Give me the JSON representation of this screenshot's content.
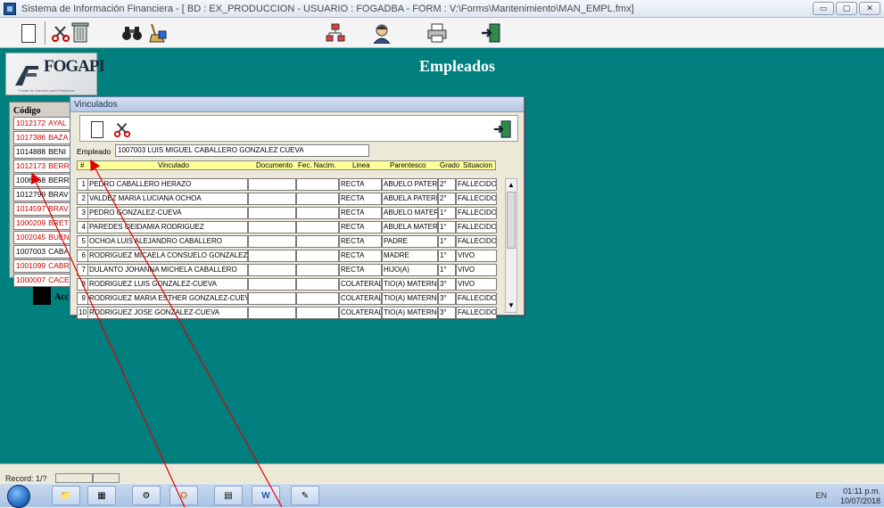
{
  "window": {
    "title": "Sistema de Información Financiera - [ BD : EX_PRODUCCION - USUARIO : FOGADBA - FORM : V:\\Forms\\Mantenimiento\\MAN_EMPL.fmx]",
    "buttons": [
      "▭",
      "▢",
      "✕"
    ]
  },
  "toolbar": {
    "new_icon": "document-icon",
    "cut_icon": "scissors-icon",
    "delete_icon": "trash-icon",
    "search_icon": "binoculars-icon",
    "clear_icon": "broom-icon",
    "org_icon": "hierarchy-icon",
    "user_icon": "user-icon",
    "print_icon": "printer-icon",
    "exit_icon": "exit-door-icon"
  },
  "logo": {
    "text": "FOGAPI",
    "sub": "Fondo de Garantía para Préstamos"
  },
  "page": {
    "heading": "Empleados"
  },
  "employees": {
    "header": "Código",
    "rows": [
      {
        "code": "1012172",
        "name": "AYAL",
        "red": true
      },
      {
        "code": "1017386",
        "name": "BAZA",
        "red": true
      },
      {
        "code": "1014888",
        "name": "BENI",
        "red": false
      },
      {
        "code": "1012173",
        "name": "BERR",
        "red": true
      },
      {
        "code": "1006168",
        "name": "BERR",
        "red": false
      },
      {
        "code": "1012799",
        "name": "BRAV",
        "red": false
      },
      {
        "code": "1014597",
        "name": "BRAV",
        "red": true
      },
      {
        "code": "1000209",
        "name": "BRET",
        "red": true
      },
      {
        "code": "1002045",
        "name": "BUEN",
        "red": true
      },
      {
        "code": "1007003",
        "name": "CABA",
        "red": false
      },
      {
        "code": "1001099",
        "name": "CABR",
        "red": true
      },
      {
        "code": "1000007",
        "name": "CACE",
        "red": true
      }
    ],
    "acc_label": "Acc"
  },
  "dialog": {
    "title": "Vinculados",
    "empleado_label": "Empleado",
    "empleado_value": "1007003 LUIS MIGUEL CABALLERO GONZALEZ CUEVA",
    "columns": {
      "num": "#",
      "vinculado": "Vinculado",
      "documento": "Documento",
      "fec_nacim": "Fec. Nacim.",
      "linea": "Linea",
      "parentesco": "Parentesco",
      "grado": "Grado",
      "situacion": "Situacion"
    },
    "rows": [
      {
        "num": "1",
        "vinculado": "PEDRO CABALLERO HERAZO",
        "documento": "",
        "fec": "",
        "linea": "RECTA",
        "parentesco": "ABUELO PATERN",
        "grado": "2°",
        "situacion": "FALLECIDO"
      },
      {
        "num": "2",
        "vinculado": "VALDEZ MARIA LUCIANA OCHOA",
        "documento": "",
        "fec": "",
        "linea": "RECTA",
        "parentesco": "ABUELA PATERN",
        "grado": "2°",
        "situacion": "FALLECIDO"
      },
      {
        "num": "3",
        "vinculado": "PEDRO GONZALEZ-CUEVA",
        "documento": "",
        "fec": "",
        "linea": "RECTA",
        "parentesco": "ABUELO MATERN",
        "grado": "1°",
        "situacion": "FALLECIDO"
      },
      {
        "num": "4",
        "vinculado": "PAREDES OEIDAMIA RODRIGUEZ",
        "documento": "",
        "fec": "",
        "linea": "RECTA",
        "parentesco": "ABUELA MATERN",
        "grado": "1°",
        "situacion": "FALLECIDO"
      },
      {
        "num": "5",
        "vinculado": "OCHOA LUIS ALEJANDRO CABALLERO",
        "documento": "",
        "fec": "",
        "linea": "RECTA",
        "parentesco": "PADRE",
        "grado": "1°",
        "situacion": "FALLECIDO"
      },
      {
        "num": "6",
        "vinculado": "RODRIGUEZ MICAELA CONSUELO GONZALEZ-CU",
        "documento": "",
        "fec": "",
        "linea": "RECTA",
        "parentesco": "MADRE",
        "grado": "1°",
        "situacion": "VIVO"
      },
      {
        "num": "7",
        "vinculado": "DULANTO JOHANNA MICHELA CABALLERO",
        "documento": "",
        "fec": "",
        "linea": "RECTA",
        "parentesco": "HIJO(A)",
        "grado": "1°",
        "situacion": "VIVO"
      },
      {
        "num": "8",
        "vinculado": "RODRIGUEZ LUIS GONZALEZ-CUEVA",
        "documento": "",
        "fec": "",
        "linea": "COLATERAL",
        "parentesco": "TIO(A) MATERNO",
        "grado": "3°",
        "situacion": "VIVO"
      },
      {
        "num": "9",
        "vinculado": "RODRIGUEZ MARIA ESTHER GONZALEZ-CUEVA",
        "documento": "",
        "fec": "",
        "linea": "COLATERAL",
        "parentesco": "TIO(A) MATERNO",
        "grado": "3°",
        "situacion": "FALLECIDO"
      },
      {
        "num": "10",
        "vinculado": "RODRIGUEZ JOSE GONZALEZ-CUEVA",
        "documento": "",
        "fec": "",
        "linea": "COLATERAL",
        "parentesco": "TIO(A) MATERNO",
        "grado": "3°",
        "situacion": "FALLECIDO"
      }
    ]
  },
  "status": {
    "record": "Record: 1/?"
  },
  "taskbar": {
    "apps": [
      "folder-icon",
      "calendar-icon",
      "network-icon",
      "outlook-icon",
      "forms-icon",
      "word-icon",
      "designer-icon"
    ],
    "tray_text": "EN",
    "time": "01:11 p.m.",
    "date": "10/07/2018"
  },
  "colors": {
    "canvas": "#007f7f",
    "red_text": "#d00000",
    "header_yellow": "#ffff99",
    "arrow_red": "#e00000"
  }
}
